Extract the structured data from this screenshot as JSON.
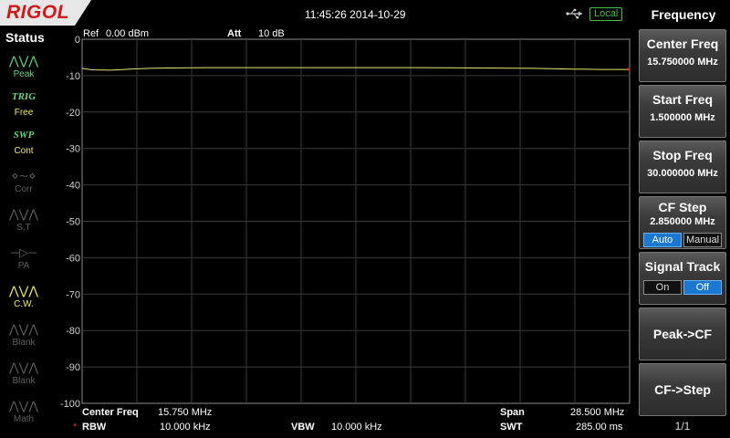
{
  "header": {
    "brand": "RIGOL",
    "datetime": "11:45:26 2014-10-29",
    "remote_status": "Local"
  },
  "status_panel": {
    "title": "Status",
    "items": [
      {
        "icon": "peak-icon",
        "top": "",
        "label": "Peak",
        "state": "on"
      },
      {
        "icon": "trig-icon",
        "top": "TRIG",
        "label": "Free",
        "state": "on"
      },
      {
        "icon": "swp-icon",
        "top": "SWP",
        "label": "Cont",
        "state": "on"
      },
      {
        "icon": "corr-icon",
        "top": "",
        "label": "Corr",
        "state": "off"
      },
      {
        "icon": "st-icon",
        "top": "",
        "label": "S.T",
        "state": "off"
      },
      {
        "icon": "pa-icon",
        "top": "",
        "label": "PA",
        "state": "off"
      },
      {
        "icon": "cw-icon",
        "top": "",
        "label": "C.W.",
        "state": "on"
      },
      {
        "icon": "blank-icon",
        "top": "",
        "label": "Blank",
        "state": "off"
      },
      {
        "icon": "blank-icon",
        "top": "",
        "label": "Blank",
        "state": "off"
      },
      {
        "icon": "math-icon",
        "top": "",
        "label": "Math",
        "state": "off"
      }
    ]
  },
  "trace_header": {
    "ref_label": "Ref",
    "ref_value": "0.00 dBm",
    "att_label": "Att",
    "att_value": "10 dB"
  },
  "y_axis_labels": [
    "0",
    "-10",
    "-20",
    "-30",
    "-40",
    "-50",
    "-60",
    "-70",
    "-80",
    "-90",
    "-100"
  ],
  "bottom_info": {
    "center_label": "Center Freq",
    "center_value": "15.750 MHz",
    "span_label": "Span",
    "span_value": "28.500 MHz",
    "rbw_marker": "*",
    "rbw_label": "RBW",
    "rbw_value": "10.000 kHz",
    "vbw_label": "VBW",
    "vbw_value": "10.000 kHz",
    "swt_label": "SWT",
    "swt_value": "285.00 ms"
  },
  "menu": {
    "title": "Frequency",
    "center_freq": {
      "label": "Center Freq",
      "value": "15.750000 MHz"
    },
    "start_freq": {
      "label": "Start Freq",
      "value": "1.500000 MHz"
    },
    "stop_freq": {
      "label": "Stop Freq",
      "value": "30.000000 MHz"
    },
    "cf_step": {
      "label": "CF Step",
      "value": "2.850000 MHz",
      "opt_auto": "Auto",
      "opt_manual": "Manual",
      "selected": "Auto"
    },
    "signal_track": {
      "label": "Signal Track",
      "opt_on": "On",
      "opt_off": "Off",
      "selected": "Off"
    },
    "peak_cf": "Peak->CF",
    "cf_step_action": "CF->Step",
    "page": "1/1"
  },
  "colors": {
    "trace": "#e8e870",
    "grid": "#3a3a3a",
    "active_toggle": "#1a78d0",
    "brand_red": "#d01a1a"
  },
  "chart_data": {
    "type": "line",
    "title": "",
    "xlabel": "",
    "ylabel": "",
    "x": [
      1.5,
      2.0,
      3.0,
      4.0,
      5.0,
      6.0,
      8.0,
      10.0,
      13.0,
      16.0,
      19.0,
      22.0,
      25.0,
      27.0,
      28.5,
      30.0
    ],
    "series": [
      {
        "values": [
          -8.0,
          -8.4,
          -8.5,
          -8.2,
          -8.0,
          -7.9,
          -7.8,
          -7.8,
          -7.8,
          -7.8,
          -7.8,
          -7.9,
          -8.0,
          -8.2,
          -8.3,
          -8.3
        ]
      }
    ],
    "xlim": [
      1.5,
      30.0
    ],
    "ylim": [
      -100,
      0
    ],
    "grid": true
  }
}
